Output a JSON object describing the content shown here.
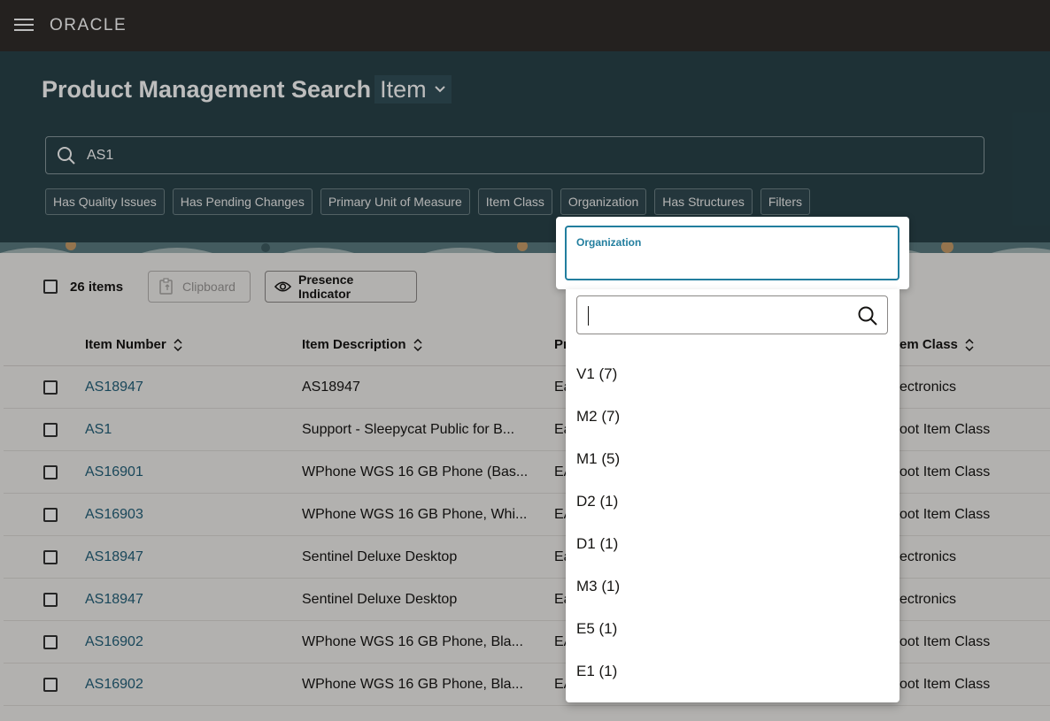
{
  "header": {
    "logo": "ORACLE"
  },
  "page": {
    "title": "Product Management Search",
    "type_selector": "Item"
  },
  "search": {
    "value": "AS1"
  },
  "filter_chips": [
    "Has Quality Issues",
    "Has Pending Changes",
    "Primary Unit of Measure",
    "Item Class",
    "Organization",
    "Has Structures",
    "Filters"
  ],
  "toolbar": {
    "count": "26 items",
    "clipboard_label": "Clipboard",
    "presence_label": "Presence Indicator"
  },
  "table": {
    "columns": [
      "Item Number",
      "Item Description",
      "Pr",
      "em Class"
    ],
    "rows": [
      {
        "number": "AS18947",
        "description": "AS18947",
        "p": "Ea",
        "item_class": "ectronics"
      },
      {
        "number": "AS1",
        "description": "Support - Sleepycat Public for B...",
        "p": "Ea",
        "item_class": "oot Item Class"
      },
      {
        "number": "AS16901",
        "description": "WPhone WGS 16 GB Phone (Bas...",
        "p": "EA",
        "item_class": "oot Item Class"
      },
      {
        "number": "AS16903",
        "description": "WPhone WGS 16 GB Phone, Whi...",
        "p": "EA",
        "item_class": "oot Item Class"
      },
      {
        "number": "AS18947",
        "description": "Sentinel Deluxe Desktop",
        "p": "Ea",
        "item_class": "ectronics"
      },
      {
        "number": "AS18947",
        "description": "Sentinel Deluxe Desktop",
        "p": "Ea",
        "item_class": "ectronics"
      },
      {
        "number": "AS16902",
        "description": "WPhone WGS 16 GB Phone, Bla...",
        "p": "EA",
        "item_class": "oot Item Class"
      },
      {
        "number": "AS16902",
        "description": "WPhone WGS 16 GB Phone, Bla...",
        "p": "EA",
        "item_class": "oot Item Class"
      }
    ]
  },
  "org_popup": {
    "label": "Organization",
    "search_value": "",
    "options": [
      "V1 (7)",
      "M2 (7)",
      "M1 (5)",
      "D2 (1)",
      "D1 (1)",
      "M3 (1)",
      "E5 (1)",
      "E1 (1)"
    ]
  },
  "colors": {
    "topbar": "#312d2a",
    "hero": "#29434a",
    "link": "#23617a",
    "focus": "#227e9e"
  }
}
